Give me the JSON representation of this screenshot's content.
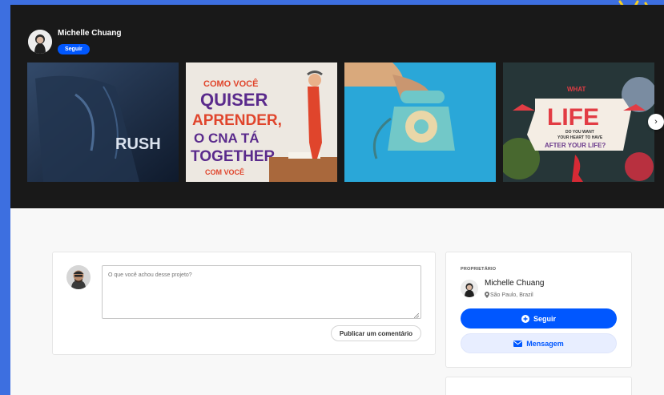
{
  "project_header": {
    "owner_name": "Michelle Chuang",
    "follow_label": "Seguir"
  },
  "thumbnails": [
    {
      "name": "rush-bag",
      "label": "RUSH"
    },
    {
      "name": "cna-poster",
      "lines": [
        "COMO VOCÊ",
        "QUISER",
        "APRENDER,",
        "O CNA TÁ",
        "TOGETHER",
        "COM VOCÊ"
      ]
    },
    {
      "name": "telephone",
      "label": ""
    },
    {
      "name": "what-life",
      "lines": [
        "WHAT",
        "LIFE",
        "DO YOU WANT",
        "YOUR HEART TO HAVE",
        "AFTER YOUR LIFE?"
      ]
    }
  ],
  "comment": {
    "placeholder": "O que você achou desse projeto?",
    "publish_label": "Publicar um comentário"
  },
  "owner_card": {
    "label": "PROPRIETÁRIO",
    "name": "Michelle Chuang",
    "location": "São Paulo, Brazil",
    "follow_label": "Seguir",
    "message_label": "Mensagem"
  },
  "colors": {
    "accent": "#0057ff",
    "page_bg": "#3d6fe0",
    "dark_panel": "#191919"
  }
}
